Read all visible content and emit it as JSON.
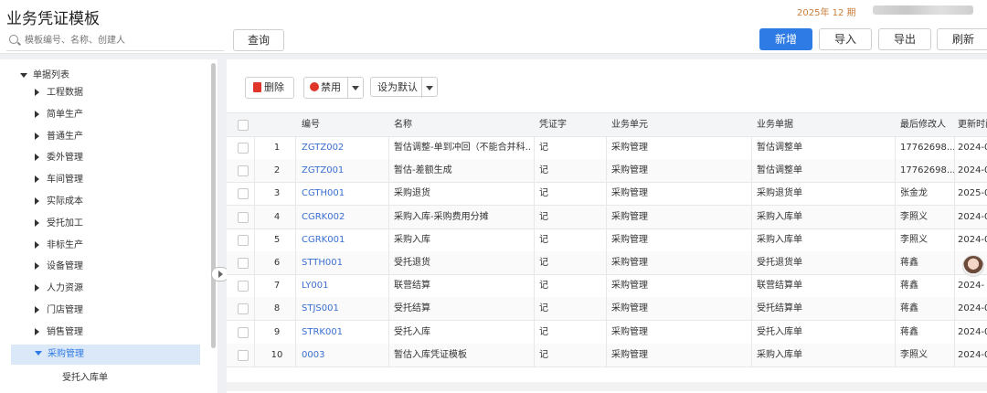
{
  "header": {
    "title": "业务凭证模板",
    "period": "2025年 12 期"
  },
  "search": {
    "placeholder": "模板编号、名称、创建人",
    "query_label": "查询"
  },
  "actions": {
    "new_label": "新增",
    "import_label": "导入",
    "export_label": "导出",
    "refresh_label": "刷新"
  },
  "colors": {
    "accent": "#2f7be5",
    "danger": "#e0352b",
    "period": "#c87e3b"
  },
  "sidebar": {
    "root_label": "单据列表",
    "items": [
      {
        "label": "工程数据"
      },
      {
        "label": "简单生产"
      },
      {
        "label": "普通生产"
      },
      {
        "label": "委外管理"
      },
      {
        "label": "车间管理"
      },
      {
        "label": "实际成本"
      },
      {
        "label": "受托加工"
      },
      {
        "label": "非标生产"
      },
      {
        "label": "设备管理"
      },
      {
        "label": "人力资源"
      },
      {
        "label": "门店管理"
      },
      {
        "label": "销售管理"
      },
      {
        "label": "采购管理"
      }
    ],
    "subitem_label": "受托入库单"
  },
  "toolbar": {
    "delete_label": "删除",
    "disable_label": "禁用",
    "set_default_label": "设为默认"
  },
  "table": {
    "headers": [
      "编号",
      "名称",
      "凭证字",
      "业务单元",
      "业务单据",
      "最后修改人",
      "更新时间"
    ],
    "rows": [
      {
        "no": "1",
        "code": "ZGTZ002",
        "name": "暂估调整-单到冲回（不能合并科...",
        "voucher": "记",
        "unit": "采购管理",
        "doc": "暂估调整单",
        "modifier": "17762698...",
        "time": "2024-0"
      },
      {
        "no": "2",
        "code": "ZGTZ001",
        "name": "暂估-差额生成",
        "voucher": "记",
        "unit": "采购管理",
        "doc": "暂估调整单",
        "modifier": "17762698...",
        "time": "2024-0"
      },
      {
        "no": "3",
        "code": "CGTH001",
        "name": "采购退货",
        "voucher": "记",
        "unit": "采购管理",
        "doc": "采购退货单",
        "modifier": "张金龙",
        "time": "2025-0"
      },
      {
        "no": "4",
        "code": "CGRK002",
        "name": "采购入库-采购费用分摊",
        "voucher": "记",
        "unit": "采购管理",
        "doc": "采购入库单",
        "modifier": "李照义",
        "time": "2024-0"
      },
      {
        "no": "5",
        "code": "CGRK001",
        "name": "采购入库",
        "voucher": "记",
        "unit": "采购管理",
        "doc": "采购入库单",
        "modifier": "李照义",
        "time": "2024-0"
      },
      {
        "no": "6",
        "code": "STTH001",
        "name": "受托退货",
        "voucher": "记",
        "unit": "采购管理",
        "doc": "受托退货单",
        "modifier": "蒋鑫",
        "time": ""
      },
      {
        "no": "7",
        "code": "LY001",
        "name": "联营结算",
        "voucher": "记",
        "unit": "采购管理",
        "doc": "联营结算单",
        "modifier": "蒋鑫",
        "time": "2024-"
      },
      {
        "no": "8",
        "code": "STJS001",
        "name": "受托结算",
        "voucher": "记",
        "unit": "采购管理",
        "doc": "受托结算单",
        "modifier": "蒋鑫",
        "time": "2024-0"
      },
      {
        "no": "9",
        "code": "STRK001",
        "name": "受托入库",
        "voucher": "记",
        "unit": "采购管理",
        "doc": "受托入库单",
        "modifier": "蒋鑫",
        "time": "2024-0"
      },
      {
        "no": "10",
        "code": "0003",
        "name": "暂估入库凭证模板",
        "voucher": "记",
        "unit": "采购管理",
        "doc": "采购入库单",
        "modifier": "李照义",
        "time": "2024-0"
      }
    ]
  }
}
